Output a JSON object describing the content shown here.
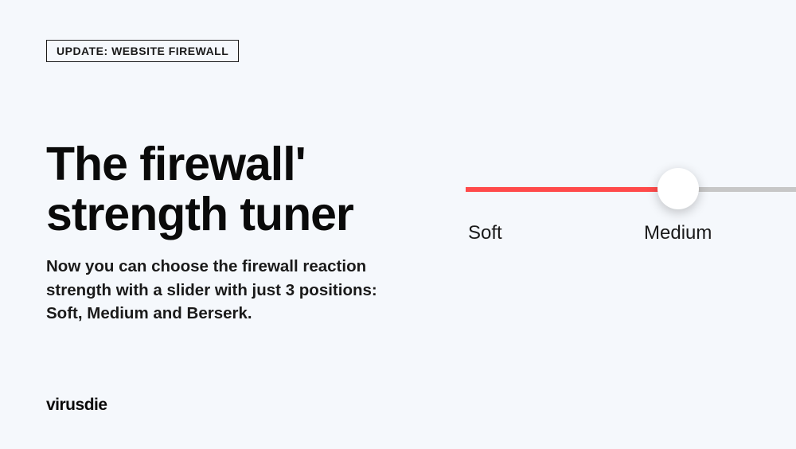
{
  "badge": "UPDATE: WEBSITE FIREWALL",
  "title": "The firewall'\nstrength tuner",
  "description": "Now you can choose the firewall reaction strength with a slider with just 3 positions: Soft, Medium and Berserk.",
  "brand": "virusdie",
  "slider": {
    "labelSoft": "Soft",
    "labelMedium": "Medium"
  }
}
